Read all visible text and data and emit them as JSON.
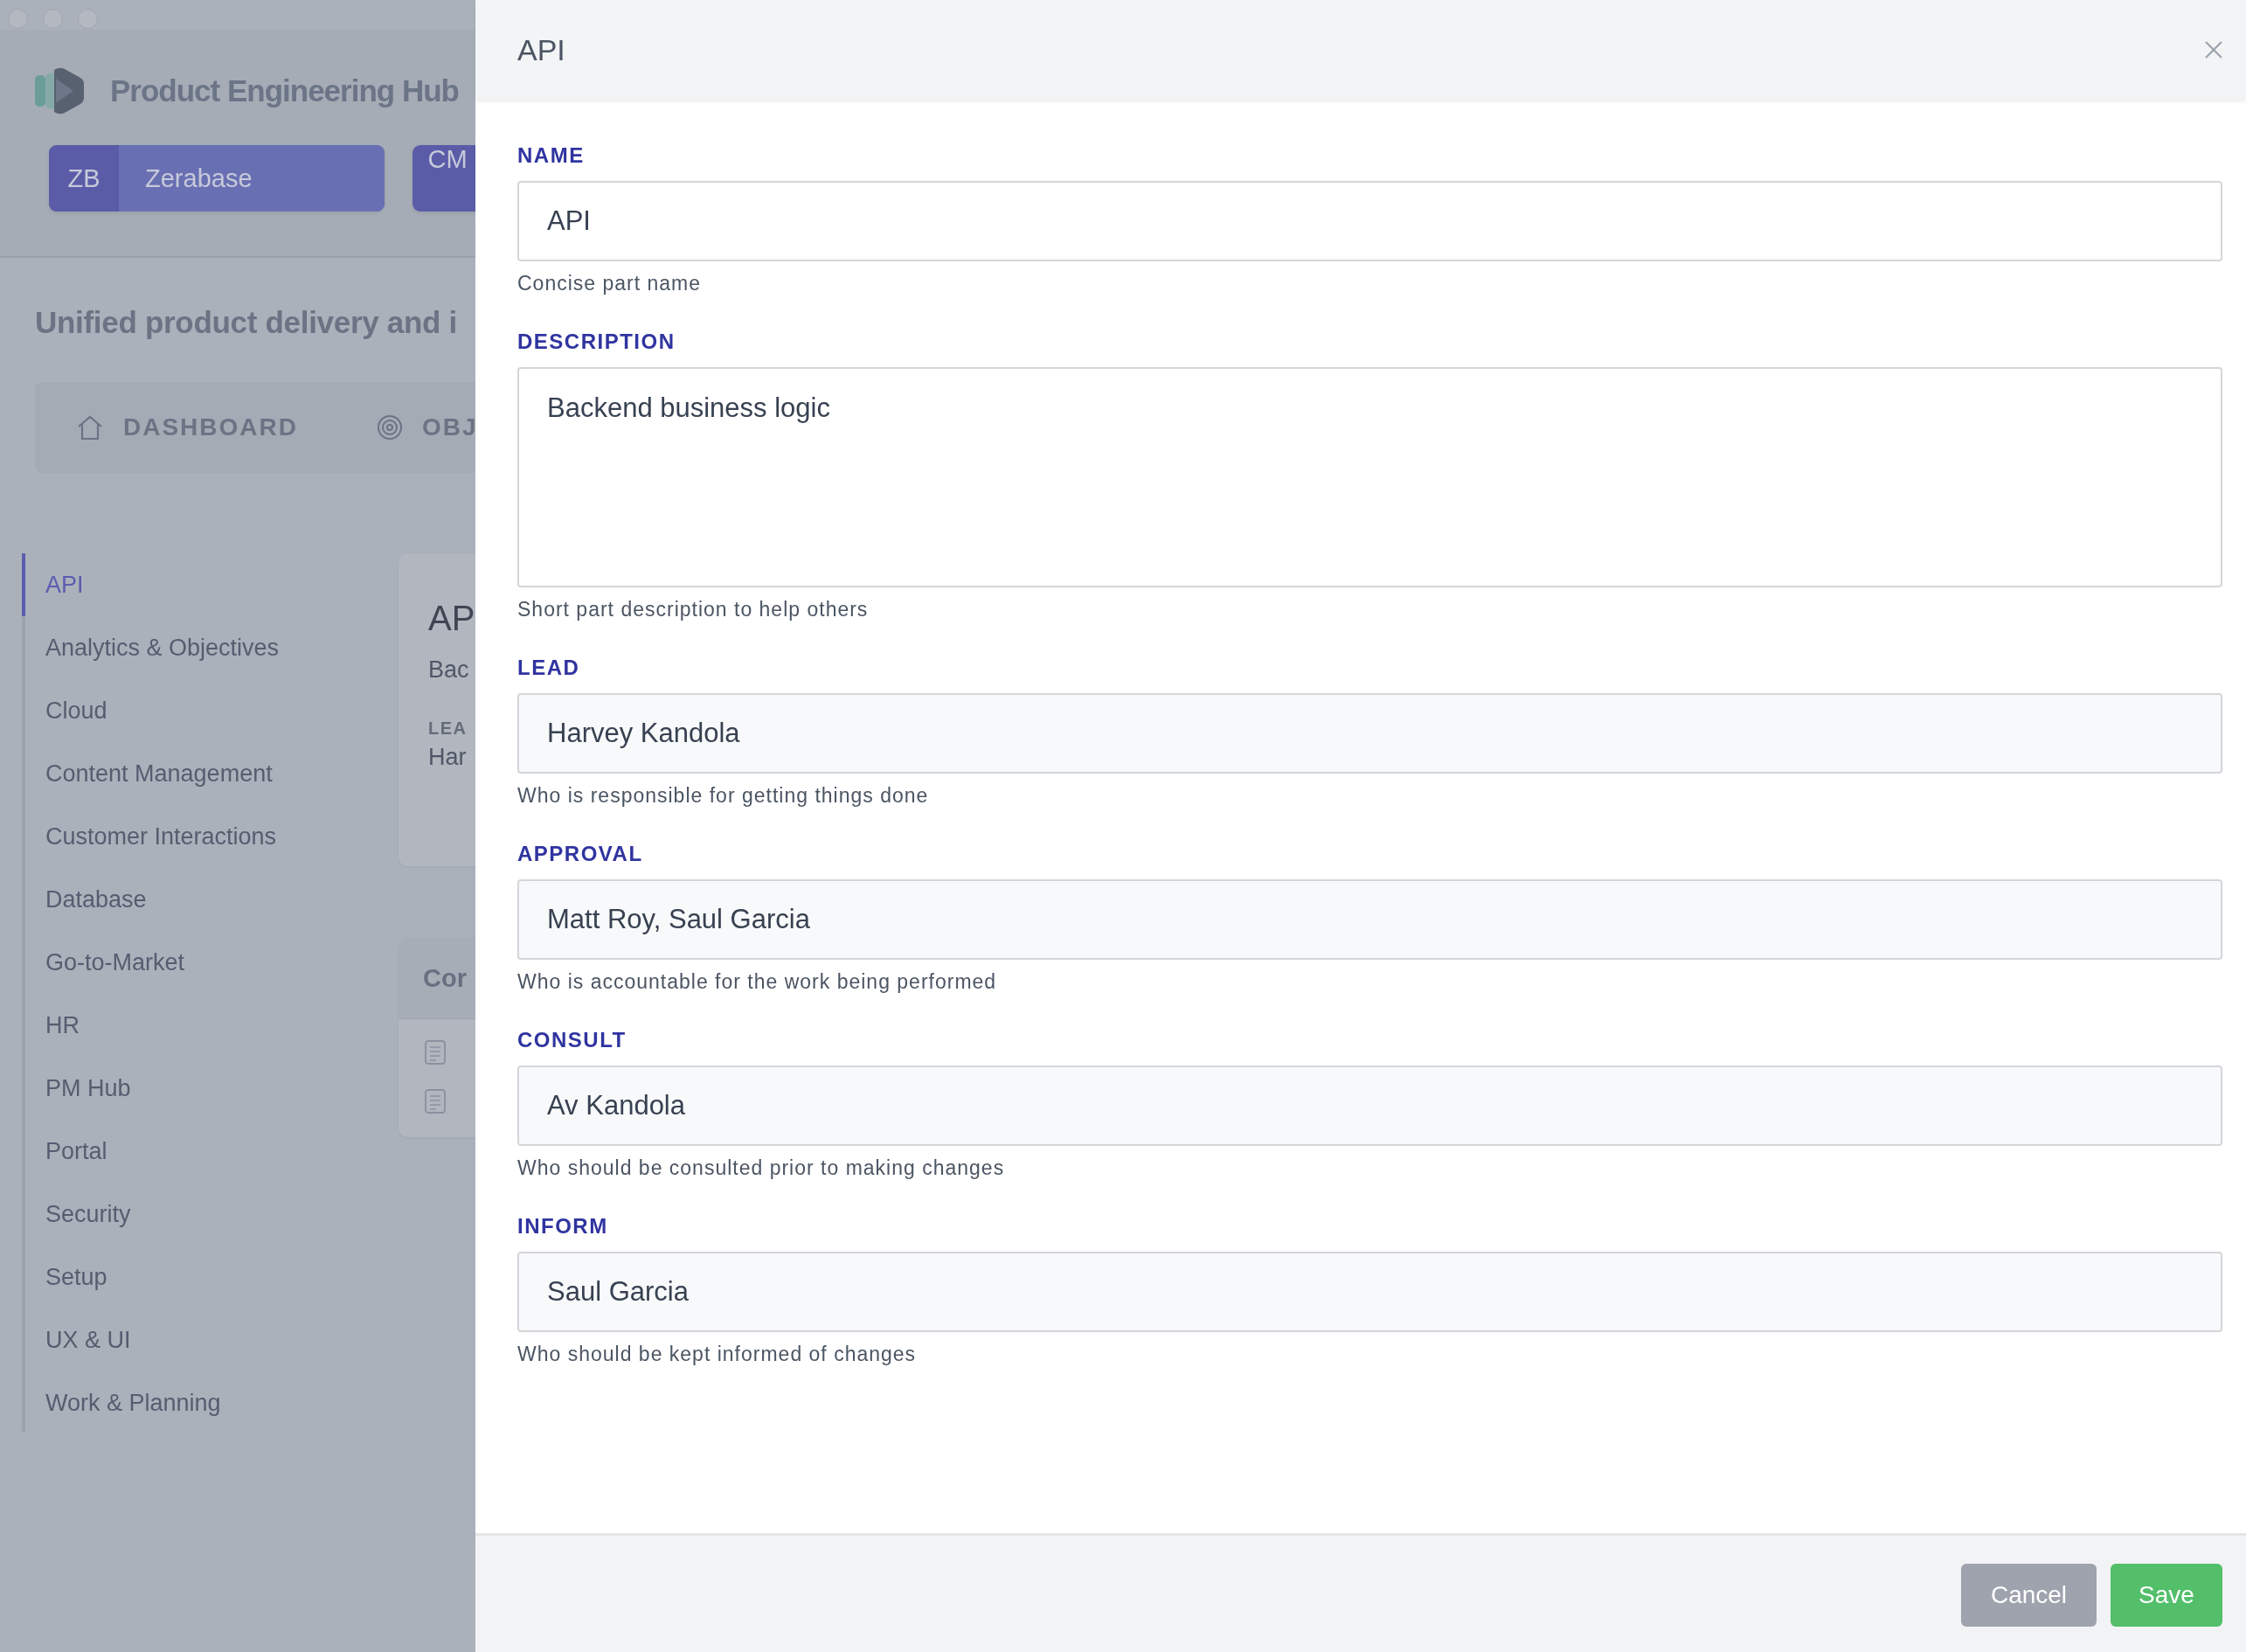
{
  "app": {
    "title": "Product Engineering Hub",
    "workspaces": [
      {
        "initials": "ZB",
        "name": "Zerabase"
      },
      {
        "initials": "CM"
      }
    ],
    "subtitle": "Unified product delivery and i",
    "nav": [
      {
        "label": "DASHBOARD"
      },
      {
        "label": "OBJ"
      }
    ],
    "sidebar": {
      "items": [
        {
          "label": "API",
          "selected": true
        },
        {
          "label": "Analytics & Objectives",
          "selected": false
        },
        {
          "label": "Cloud",
          "selected": false
        },
        {
          "label": "Content Management",
          "selected": false
        },
        {
          "label": "Customer Interactions",
          "selected": false
        },
        {
          "label": "Database",
          "selected": false
        },
        {
          "label": "Go-to-Market",
          "selected": false
        },
        {
          "label": "HR",
          "selected": false
        },
        {
          "label": "PM Hub",
          "selected": false
        },
        {
          "label": "Portal",
          "selected": false
        },
        {
          "label": "Security",
          "selected": false
        },
        {
          "label": "Setup",
          "selected": false
        },
        {
          "label": "UX & UI",
          "selected": false
        },
        {
          "label": "Work & Planning",
          "selected": false
        }
      ]
    },
    "summary_card": {
      "title": "AP",
      "description": "Bac",
      "field_label": "LEA",
      "field_value": "Har"
    },
    "list_card": {
      "title": "Cor",
      "rows": [
        {
          "kind": "document"
        },
        {
          "kind": "document"
        }
      ]
    }
  },
  "drawer": {
    "title": "API",
    "fields": [
      {
        "kind": "text",
        "label": "NAME",
        "value": "API",
        "help": "Concise part name"
      },
      {
        "kind": "textarea",
        "label": "DESCRIPTION",
        "value": "Backend business logic",
        "help": "Short part description to help others"
      },
      {
        "kind": "picker",
        "label": "LEAD",
        "value": "Harvey Kandola",
        "help": "Who is responsible for getting things done"
      },
      {
        "kind": "picker",
        "label": "APPROVAL",
        "value": "Matt Roy, Saul Garcia",
        "help": "Who is accountable for the work being performed"
      },
      {
        "kind": "picker",
        "label": "CONSULT",
        "value": "Av Kandola",
        "help": "Who should be consulted prior to making changes"
      },
      {
        "kind": "picker",
        "label": "INFORM",
        "value": "Saul Garcia",
        "help": "Who should be kept informed of changes"
      }
    ],
    "buttons": [
      {
        "kind": "secondary",
        "label": "Cancel"
      },
      {
        "kind": "primary",
        "label": "Save"
      }
    ]
  }
}
